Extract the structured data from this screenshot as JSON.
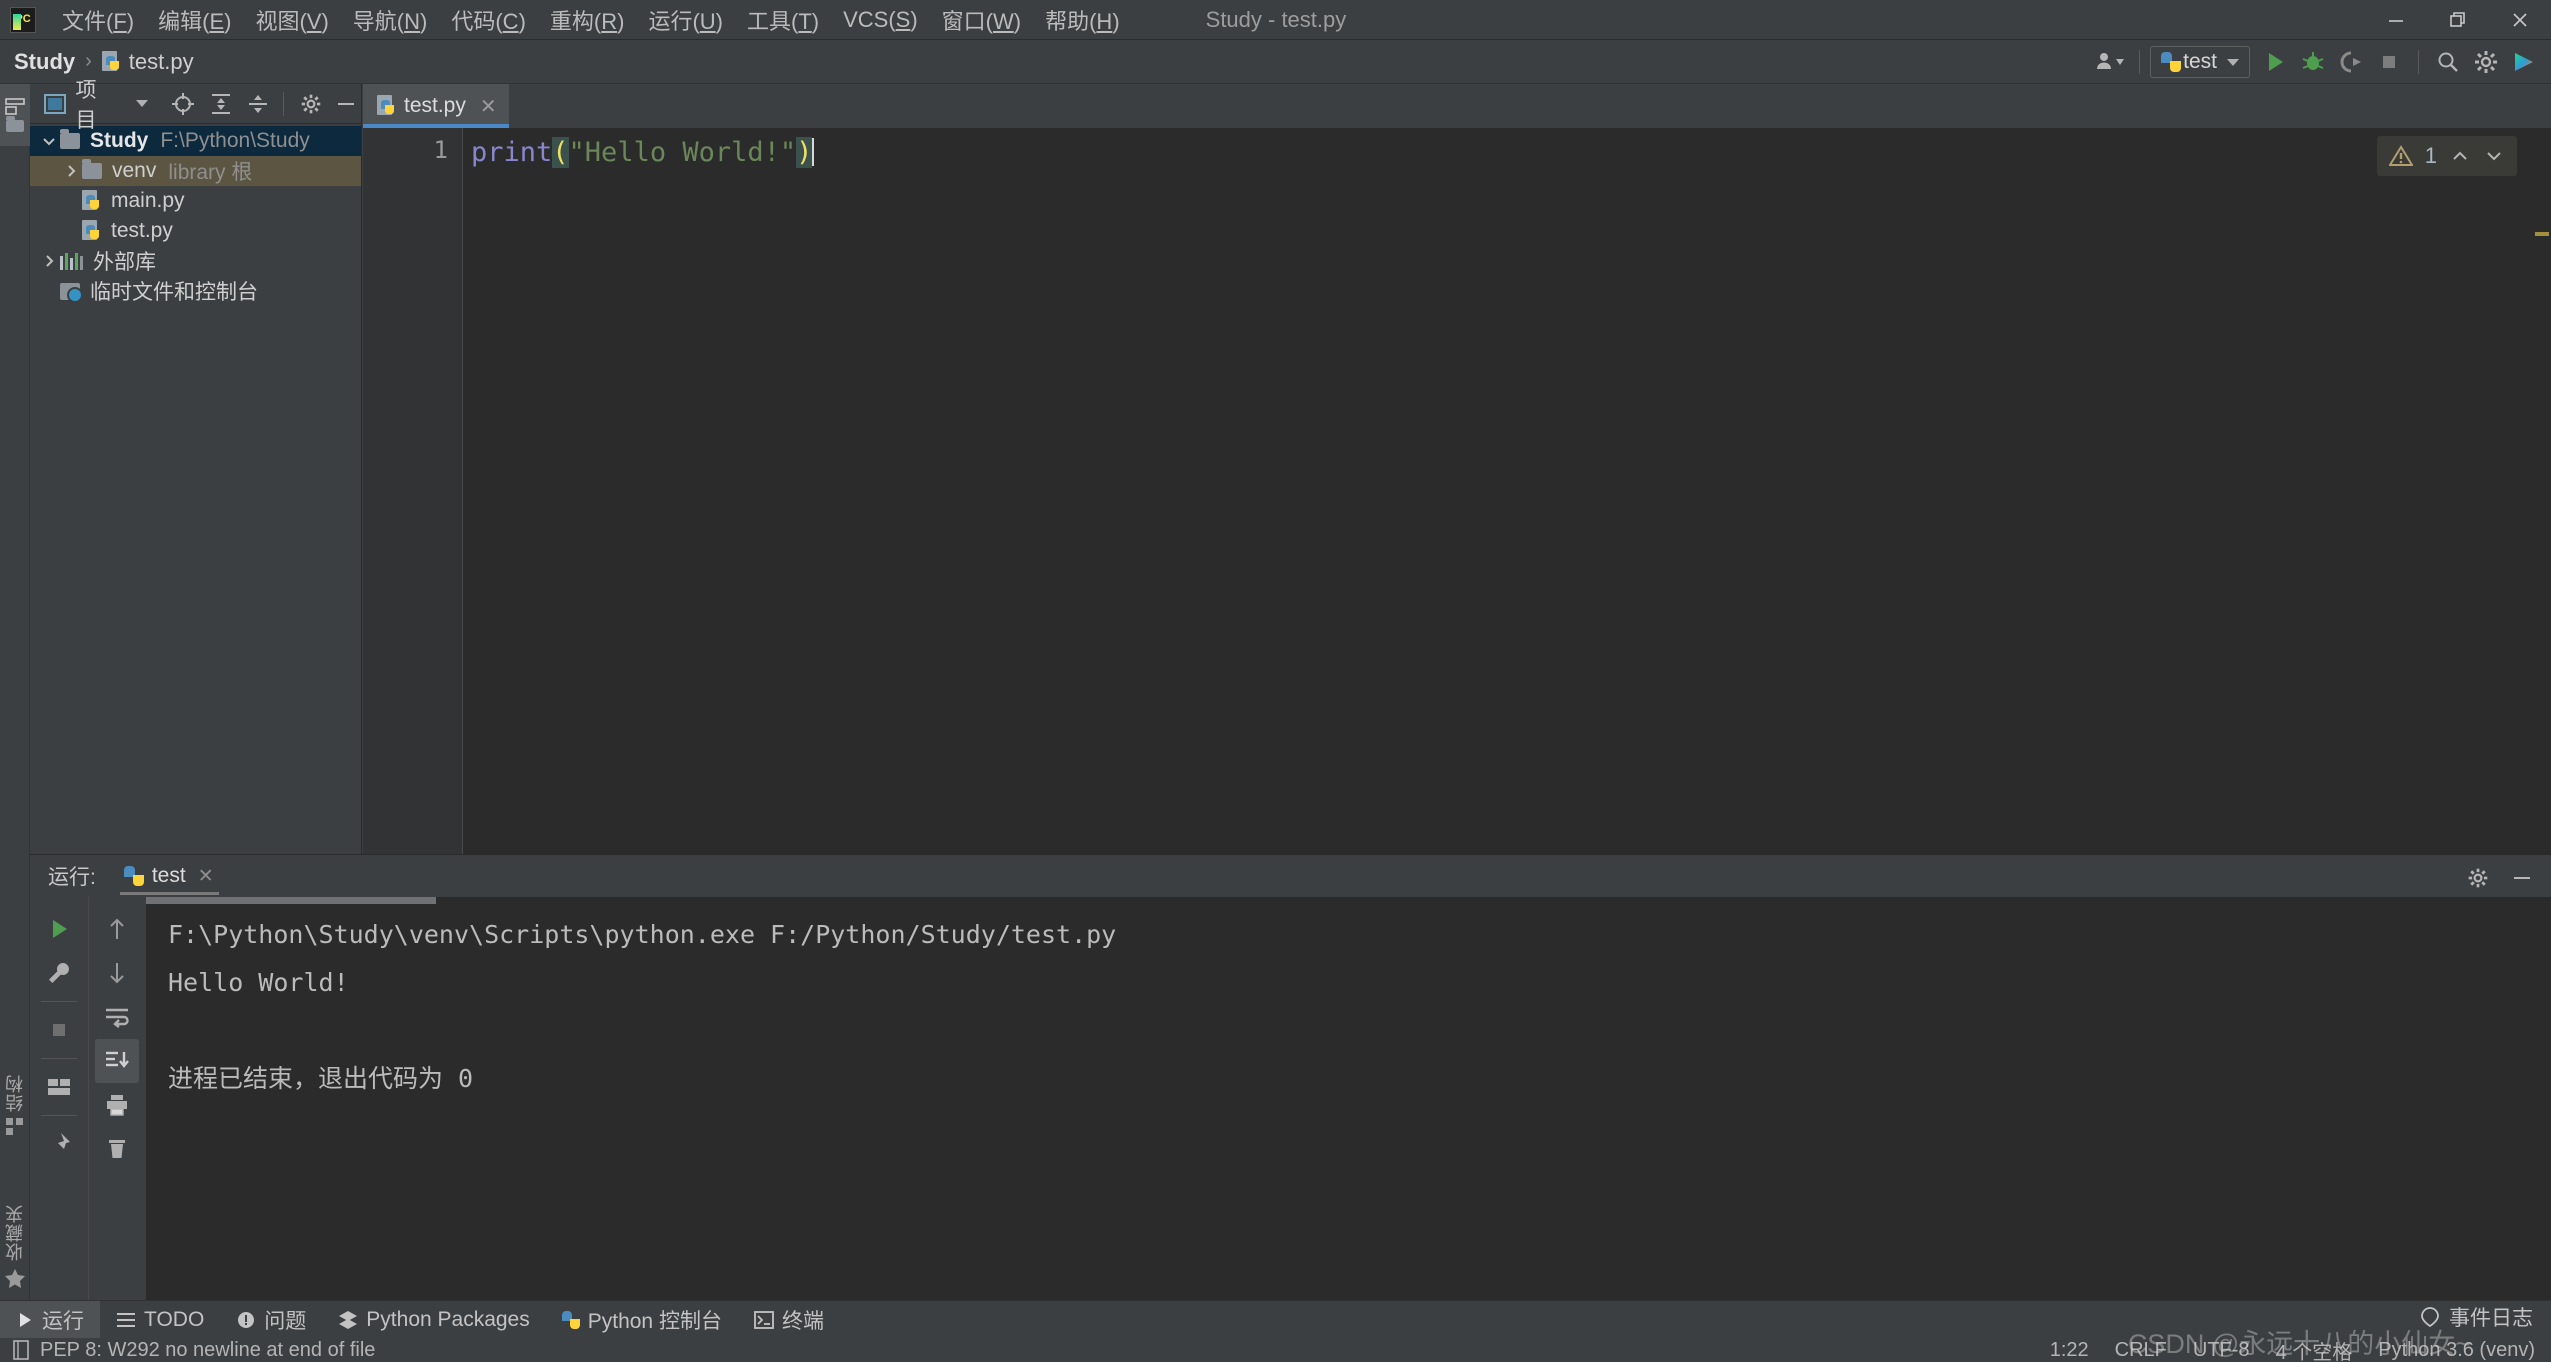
{
  "window": {
    "title": "Study - test.py",
    "app_icon": "pycharm-logo-icon",
    "controls": {
      "minimize": "minimize-icon",
      "restore": "restore-icon",
      "close": "close-icon"
    }
  },
  "menubar": {
    "items": [
      {
        "label": "文件(F)",
        "text": "文件",
        "mnemonic": "F"
      },
      {
        "label": "编辑(E)",
        "text": "编辑",
        "mnemonic": "E"
      },
      {
        "label": "视图(V)",
        "text": "视图",
        "mnemonic": "V"
      },
      {
        "label": "导航(N)",
        "text": "导航",
        "mnemonic": "N"
      },
      {
        "label": "代码(C)",
        "text": "代码",
        "mnemonic": "C"
      },
      {
        "label": "重构(R)",
        "text": "重构",
        "mnemonic": "R"
      },
      {
        "label": "运行(U)",
        "text": "运行",
        "mnemonic": "U"
      },
      {
        "label": "工具(T)",
        "text": "工具",
        "mnemonic": "T"
      },
      {
        "label": "VCS(S)",
        "text": "VCS",
        "mnemonic": "S"
      },
      {
        "label": "窗口(W)",
        "text": "窗口",
        "mnemonic": "W"
      },
      {
        "label": "帮助(H)",
        "text": "帮助",
        "mnemonic": "H"
      }
    ]
  },
  "navbar": {
    "breadcrumb": [
      {
        "label": "Study",
        "icon": ""
      },
      {
        "label": "test.py",
        "icon": "python-file-icon"
      }
    ],
    "separator": "›"
  },
  "toolbar": {
    "run_config": {
      "label": "test",
      "icon": "python-config-icon"
    },
    "buttons": [
      {
        "name": "account-icon",
        "label": ""
      },
      {
        "name": "run-icon",
        "label": ""
      },
      {
        "name": "debug-icon",
        "label": ""
      },
      {
        "name": "run-coverage-icon",
        "label": ""
      },
      {
        "name": "stop-icon",
        "label": ""
      },
      {
        "name": "search-icon",
        "label": ""
      },
      {
        "name": "settings-gear-icon",
        "label": ""
      },
      {
        "name": "updates-icon",
        "label": ""
      }
    ]
  },
  "left_strip": {
    "project_button": "项目",
    "structure_button": "结构",
    "favorites_button": "收藏夹"
  },
  "project_panel": {
    "title": "项目",
    "header_icons": [
      "project-view-icon",
      "chevron-down-icon",
      "locate-file-icon",
      "expand-all-icon",
      "collapse-all-icon",
      "settings-gear-icon",
      "hide-icon"
    ],
    "tree": [
      {
        "name": "Study",
        "detail": "F:\\Python\\Study",
        "type": "folder",
        "state": "expanded",
        "selected": true,
        "depth": 0
      },
      {
        "name": "venv",
        "detail": "library 根",
        "type": "folder",
        "state": "collapsed",
        "hover": true,
        "depth": 1
      },
      {
        "name": "main.py",
        "detail": "",
        "type": "python",
        "state": "leaf",
        "depth": 2
      },
      {
        "name": "test.py",
        "detail": "",
        "type": "python",
        "state": "leaf",
        "depth": 2
      },
      {
        "name": "外部库",
        "detail": "",
        "type": "library",
        "state": "collapsed",
        "depth": 0
      },
      {
        "name": "临时文件和控制台",
        "detail": "",
        "type": "scratch",
        "state": "leaf",
        "depth": 0
      }
    ]
  },
  "editor": {
    "tab": {
      "label": "test.py",
      "icon": "python-file-icon",
      "close": "✕"
    },
    "line_number": "1",
    "code": {
      "fn": "print",
      "open_paren": "(",
      "string": "\"Hello World!\"",
      "close_paren": ")"
    },
    "inspections": {
      "count": "1",
      "icon": "warning-triangle-icon",
      "up": "⌃",
      "down": "⌄"
    }
  },
  "run_panel": {
    "label": "运行:",
    "tab": {
      "label": "test",
      "icon": "python-icon",
      "close": "✕"
    },
    "toolbar_left": [
      "rerun-icon",
      "wrench-icon",
      "stop-icon",
      "layout-icon",
      "pin-icon"
    ],
    "toolbar_right": [
      "arrow-up-icon",
      "arrow-down-icon",
      "soft-wrap-icon",
      "scroll-to-end-icon",
      "print-icon",
      "trash-icon"
    ],
    "header_icons": [
      "settings-gear-icon",
      "hide-icon"
    ],
    "console_lines": [
      "F:\\Python\\Study\\venv\\Scripts\\python.exe F:/Python/Study/test.py",
      "Hello World!",
      "",
      "进程已结束，退出代码为 0"
    ]
  },
  "bottom_bar": {
    "items": [
      {
        "label": "运行",
        "icon": "run-icon",
        "active": true
      },
      {
        "label": "TODO",
        "icon": "todo-icon",
        "active": false
      },
      {
        "label": "问题",
        "icon": "problems-icon",
        "active": false
      },
      {
        "label": "Python Packages",
        "icon": "packages-icon",
        "active": false
      },
      {
        "label": "Python 控制台",
        "icon": "python-icon",
        "active": false
      },
      {
        "label": "终端",
        "icon": "terminal-icon",
        "active": false
      }
    ],
    "event_log": {
      "label": "事件日志",
      "icon": "event-log-icon"
    }
  },
  "status_bar": {
    "inspection_message": "PEP 8: W292 no newline at end of file",
    "inspection_icon": "file-icon",
    "caret_position": "1:22",
    "line_separator": "CRLF",
    "encoding": "UTF-8",
    "indent": "4 个空格",
    "interpreter": "Python 3.6 (venv)"
  },
  "watermark": {
    "text": "CSDN @永远十八的小仙女~"
  },
  "colors": {
    "accent_blue": "#4a88c7",
    "selection_blue": "#0d293e",
    "hover_olive": "#5b5542",
    "panel_bg": "#3c3f41",
    "editor_bg": "#2b2b2b",
    "string_green": "#6a8759",
    "keyword_purple": "#8a86ce",
    "paren_yellow": "#f0e060",
    "run_green": "#4f9e4f"
  }
}
